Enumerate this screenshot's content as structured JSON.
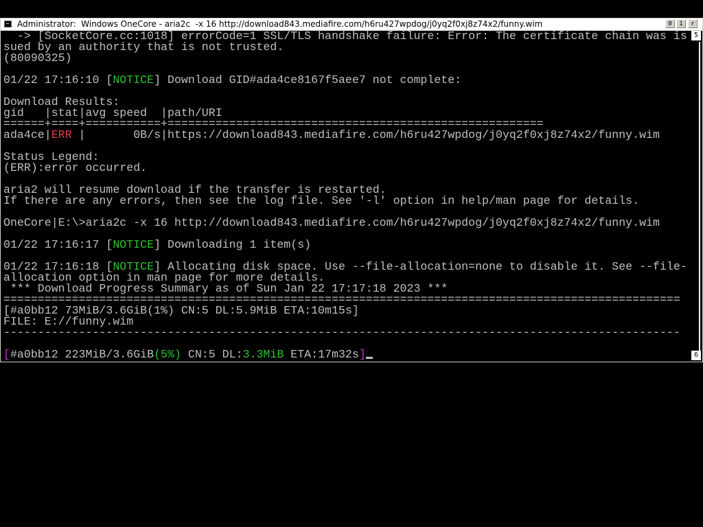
{
  "window": {
    "title": "Administrator:  Windows OneCore - aria2c  -x 16 http://download843.mediafire.com/h6ru427wpdog/j0yq2f0xj8z74x2/funny.wim",
    "buttons": {
      "minimize": "0",
      "maximize": "1",
      "close": "r"
    },
    "scroll_top_number": "5",
    "scroll_bottom_number": "6"
  },
  "console": {
    "lines": [
      {
        "segments": [
          {
            "text": "  -> [SocketCore.cc:1018] errorCode=1 SSL/TLS handshake failure: Error: The certificate chain was is",
            "color": ""
          }
        ]
      },
      {
        "segments": [
          {
            "text": "sued by an authority that is not trusted.",
            "color": ""
          }
        ]
      },
      {
        "segments": [
          {
            "text": "(80090325)",
            "color": ""
          }
        ]
      },
      {
        "segments": [
          {
            "text": "",
            "color": ""
          }
        ]
      },
      {
        "segments": [
          {
            "text": "01/22 17:16:10 [",
            "color": ""
          },
          {
            "text": "NOTICE",
            "color": "green"
          },
          {
            "text": "] Download GID#ada4ce8167f5aee7 not complete:",
            "color": ""
          }
        ]
      },
      {
        "segments": [
          {
            "text": "",
            "color": ""
          }
        ]
      },
      {
        "segments": [
          {
            "text": "Download Results:",
            "color": ""
          }
        ]
      },
      {
        "segments": [
          {
            "text": "gid   |stat|avg speed  |path/URI",
            "color": ""
          }
        ]
      },
      {
        "segments": [
          {
            "text": "======+====+===========+=======================================================",
            "color": ""
          }
        ]
      },
      {
        "segments": [
          {
            "text": "ada4ce|",
            "color": ""
          },
          {
            "text": "ERR",
            "color": "red"
          },
          {
            "text": " |       0B/s|https://download843.mediafire.com/h6ru427wpdog/j0yq2f0xj8z74x2/funny.wim",
            "color": ""
          }
        ]
      },
      {
        "segments": [
          {
            "text": "",
            "color": ""
          }
        ]
      },
      {
        "segments": [
          {
            "text": "Status Legend:",
            "color": ""
          }
        ]
      },
      {
        "segments": [
          {
            "text": "(ERR):error occurred.",
            "color": ""
          }
        ]
      },
      {
        "segments": [
          {
            "text": "",
            "color": ""
          }
        ]
      },
      {
        "segments": [
          {
            "text": "aria2 will resume download if the transfer is restarted.",
            "color": ""
          }
        ]
      },
      {
        "segments": [
          {
            "text": "If there are any errors, then see the log file. See '-l' option in help/man page for details.",
            "color": ""
          }
        ]
      },
      {
        "segments": [
          {
            "text": "",
            "color": ""
          }
        ]
      },
      {
        "segments": [
          {
            "text": "OneCore|E:\\>aria2c -x 16 http://download843.mediafire.com/h6ru427wpdog/j0yq2f0xj8z74x2/funny.wim",
            "color": ""
          }
        ]
      },
      {
        "segments": [
          {
            "text": "",
            "color": ""
          }
        ]
      },
      {
        "segments": [
          {
            "text": "01/22 17:16:17 [",
            "color": ""
          },
          {
            "text": "NOTICE",
            "color": "green"
          },
          {
            "text": "] Downloading 1 item(s)",
            "color": ""
          }
        ]
      },
      {
        "segments": [
          {
            "text": "",
            "color": ""
          }
        ]
      },
      {
        "segments": [
          {
            "text": "01/22 17:16:18 [",
            "color": ""
          },
          {
            "text": "NOTICE",
            "color": "green"
          },
          {
            "text": "] Allocating disk space. Use --file-allocation=none to disable it. See --file-",
            "color": ""
          }
        ]
      },
      {
        "segments": [
          {
            "text": "allocation option in man page for more details.",
            "color": ""
          }
        ]
      },
      {
        "segments": [
          {
            "text": " *** Download Progress Summary as of Sun Jan 22 17:17:18 2023 ***",
            "color": ""
          }
        ]
      },
      {
        "segments": [
          {
            "text": "===================================================================================================",
            "color": ""
          }
        ]
      },
      {
        "segments": [
          {
            "text": "[#a0bb12 73MiB/3.6GiB(1%) CN:5 DL:5.9MiB ETA:10m15s]",
            "color": ""
          }
        ]
      },
      {
        "segments": [
          {
            "text": "FILE: E://funny.wim",
            "color": ""
          }
        ]
      },
      {
        "segments": [
          {
            "text": "---------------------------------------------------------------------------------------------------",
            "color": ""
          }
        ]
      },
      {
        "segments": [
          {
            "text": "",
            "color": ""
          }
        ]
      },
      {
        "segments": [
          {
            "text": "[",
            "color": "magenta"
          },
          {
            "text": "#a0bb12 223MiB/3.6GiB",
            "color": ""
          },
          {
            "text": "(5%)",
            "color": "green"
          },
          {
            "text": " CN:5 DL:",
            "color": ""
          },
          {
            "text": "3.3MiB",
            "color": "green"
          },
          {
            "text": " ETA:17m32s",
            "color": ""
          },
          {
            "text": "]",
            "color": "magenta"
          }
        ]
      }
    ]
  },
  "colors": {
    "background": "#000000",
    "text": "#c0c0c0",
    "green": "#2ec12e",
    "red": "#e0403a",
    "magenta": "#c033c0"
  }
}
